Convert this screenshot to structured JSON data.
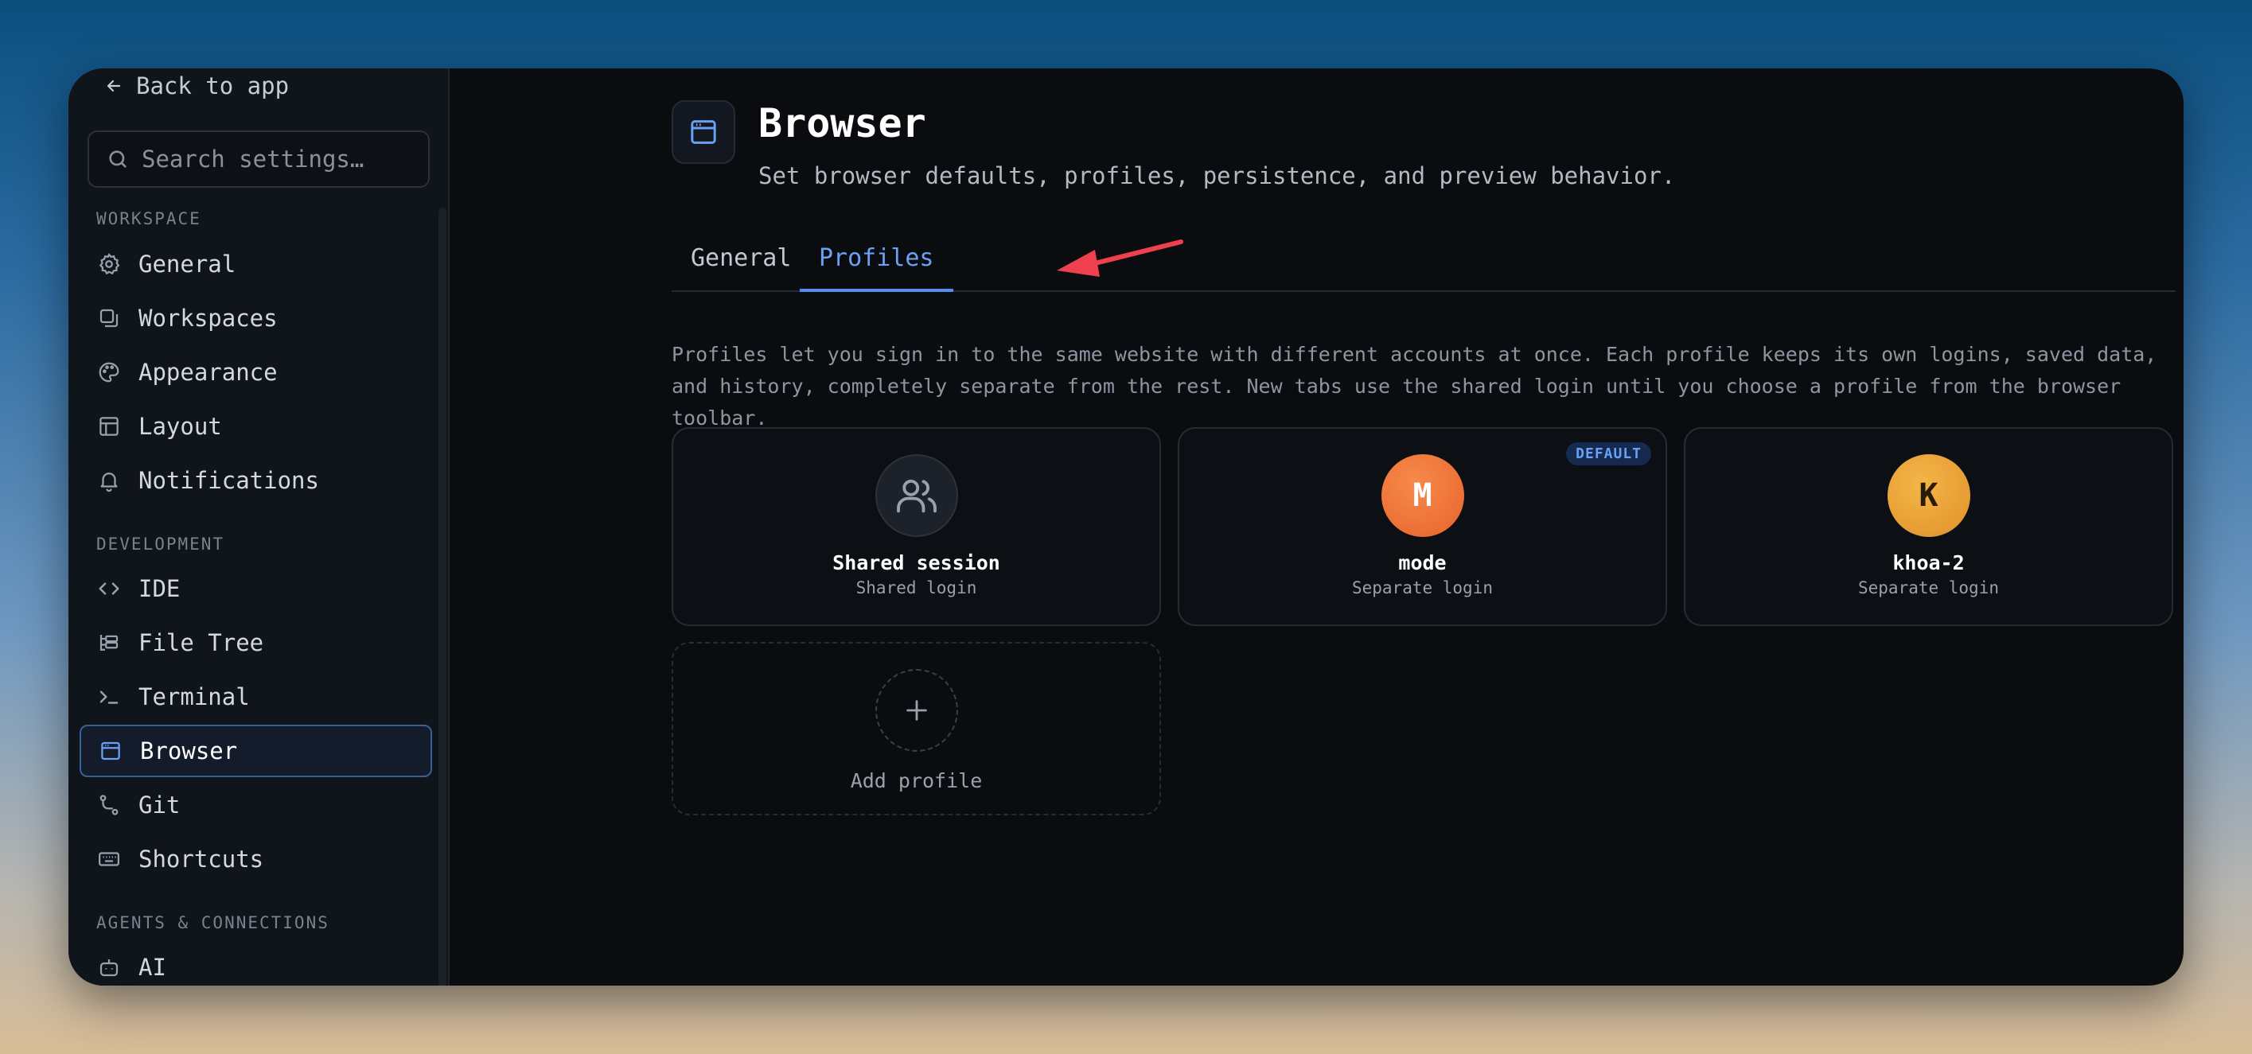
{
  "sidebar": {
    "back_label": "Back to app",
    "search_placeholder": "Search settings…",
    "sections": [
      {
        "title": "WORKSPACE",
        "items": [
          {
            "label": "General",
            "icon": "gear-icon"
          },
          {
            "label": "Workspaces",
            "icon": "workspaces-icon"
          },
          {
            "label": "Appearance",
            "icon": "palette-icon"
          },
          {
            "label": "Layout",
            "icon": "layout-icon"
          },
          {
            "label": "Notifications",
            "icon": "bell-icon"
          }
        ]
      },
      {
        "title": "DEVELOPMENT",
        "items": [
          {
            "label": "IDE",
            "icon": "code-icon"
          },
          {
            "label": "File Tree",
            "icon": "file-tree-icon"
          },
          {
            "label": "Terminal",
            "icon": "terminal-icon"
          },
          {
            "label": "Browser",
            "icon": "browser-icon",
            "active": true
          },
          {
            "label": "Git",
            "icon": "git-icon"
          },
          {
            "label": "Shortcuts",
            "icon": "keyboard-icon"
          }
        ]
      },
      {
        "title": "AGENTS & CONNECTIONS",
        "items": [
          {
            "label": "AI",
            "icon": "robot-icon"
          }
        ]
      }
    ]
  },
  "header": {
    "icon": "browser-icon",
    "title": "Browser",
    "subtitle": "Set browser defaults, profiles, persistence, and preview behavior."
  },
  "tabs": [
    {
      "label": "General",
      "active": false
    },
    {
      "label": "Profiles",
      "active": true
    }
  ],
  "description": "Profiles let you sign in to the same website with different accounts at once. Each profile keeps its own logins, saved data, and history, completely separate from the rest. New tabs use the shared login until you choose a profile from the browser toolbar.",
  "profiles": [
    {
      "name": "Shared session",
      "subtitle": "Shared login",
      "icon": "users-icon"
    },
    {
      "name": "mode",
      "subtitle": "Separate login",
      "initial": "M",
      "badge": "DEFAULT",
      "color": "#f0763a"
    },
    {
      "name": "khoa-2",
      "subtitle": "Separate login",
      "initial": "K",
      "color": "#eaa232"
    }
  ],
  "add_profile": {
    "label": "Add profile",
    "icon": "plus-icon"
  },
  "colors": {
    "accent": "#4f8ef0",
    "annotation_arrow": "#f0404f"
  }
}
